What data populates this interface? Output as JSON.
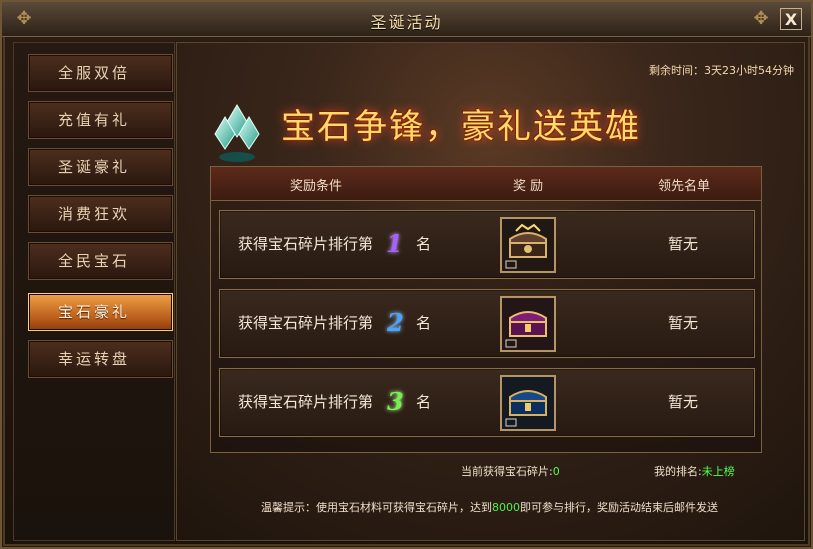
{
  "window": {
    "title": "圣诞活动",
    "close_label": "X"
  },
  "sidebar": {
    "items": [
      {
        "label": "全服双倍",
        "active": false
      },
      {
        "label": "充值有礼",
        "active": false
      },
      {
        "label": "圣诞豪礼",
        "active": false
      },
      {
        "label": "消费狂欢",
        "active": false
      },
      {
        "label": "全民宝石",
        "active": false
      },
      {
        "label": "宝石豪礼",
        "active": true
      },
      {
        "label": "幸运转盘",
        "active": false
      }
    ]
  },
  "event": {
    "timer_label": "剩余时间：",
    "timer_value": "3天23小时54分钟",
    "banner_title": "宝石争锋，豪礼送英雄"
  },
  "table": {
    "headers": [
      "奖励条件",
      "奖 励",
      "领先名单"
    ],
    "rows": [
      {
        "condition_prefix": "获得宝石碎片排行第",
        "rank": "1",
        "condition_suffix": "名",
        "leader": "暂无"
      },
      {
        "condition_prefix": "获得宝石碎片排行第",
        "rank": "2",
        "condition_suffix": "名",
        "leader": "暂无"
      },
      {
        "condition_prefix": "获得宝石碎片排行第",
        "rank": "3",
        "condition_suffix": "名",
        "leader": "暂无"
      }
    ]
  },
  "summary": {
    "current_label": "当前获得宝石碎片:",
    "current_value": "0",
    "rank_label": "我的排名:",
    "rank_value": "未上榜"
  },
  "tip": {
    "prefix": "温馨提示：使用宝石材料可获得宝石碎片，达到",
    "highlight": "8000",
    "suffix": "即可参与排行，奖励活动结束后邮件发送"
  },
  "colors": {
    "active_tab": "#d57a2a",
    "rank_1": "#a761ff",
    "rank_2": "#4aa3ff",
    "rank_3": "#74f04f",
    "highlight_green": "#4fff4f"
  }
}
